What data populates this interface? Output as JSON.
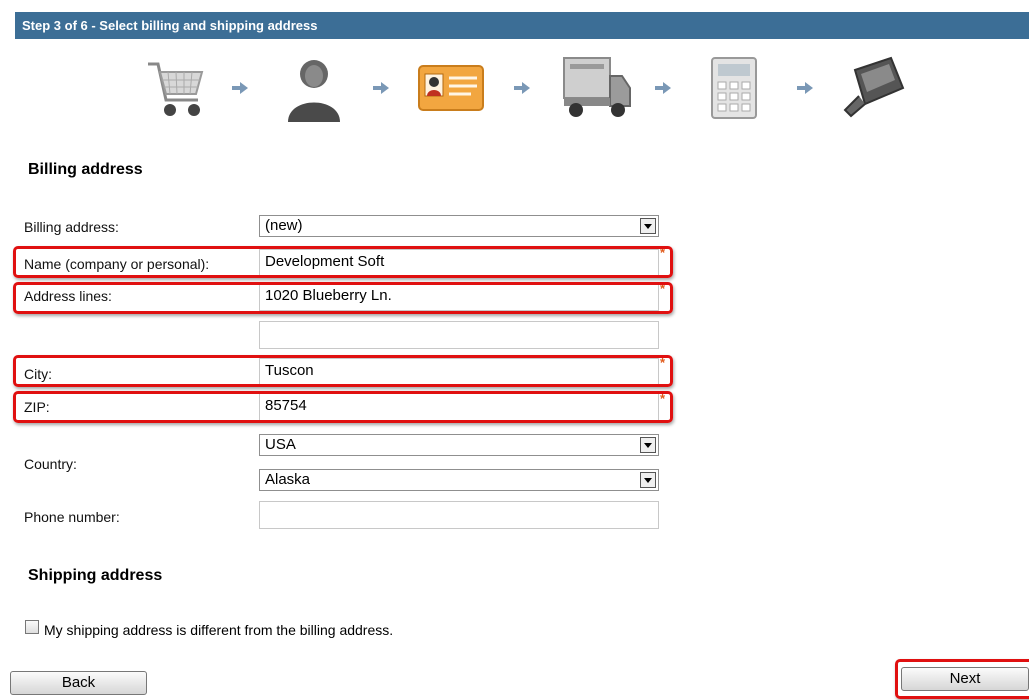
{
  "header": {
    "title": "Step 3 of 6 - Select billing and shipping address"
  },
  "steps": [
    {
      "icon": "shopping-cart-icon"
    },
    {
      "icon": "customer-icon"
    },
    {
      "icon": "address-card-icon"
    },
    {
      "icon": "shipping-truck-icon"
    },
    {
      "icon": "calculator-icon"
    },
    {
      "icon": "payment-card-icon"
    }
  ],
  "billing": {
    "section_title": "Billing address",
    "address_label": "Billing address:",
    "address_value": "(new)",
    "name_label": "Name (company or personal):",
    "name_value": "Development Soft",
    "lines_label": "Address lines:",
    "line1_value": "1020 Blueberry Ln.",
    "line2_value": "",
    "city_label": "City:",
    "city_value": "Tuscon",
    "zip_label": "ZIP:",
    "zip_value": "85754",
    "country_label": "Country:",
    "country_value": "USA",
    "state_value": "Alaska",
    "phone_label": "Phone number:",
    "phone_value": "",
    "required_mark": "*"
  },
  "shipping": {
    "section_title": "Shipping address",
    "different_label": "My shipping address is different from the billing address."
  },
  "buttons": {
    "back": "Back",
    "next": "Next"
  },
  "colors": {
    "header_bg": "#3c6e96",
    "highlight": "#e01010",
    "required": "#e05a1a"
  }
}
